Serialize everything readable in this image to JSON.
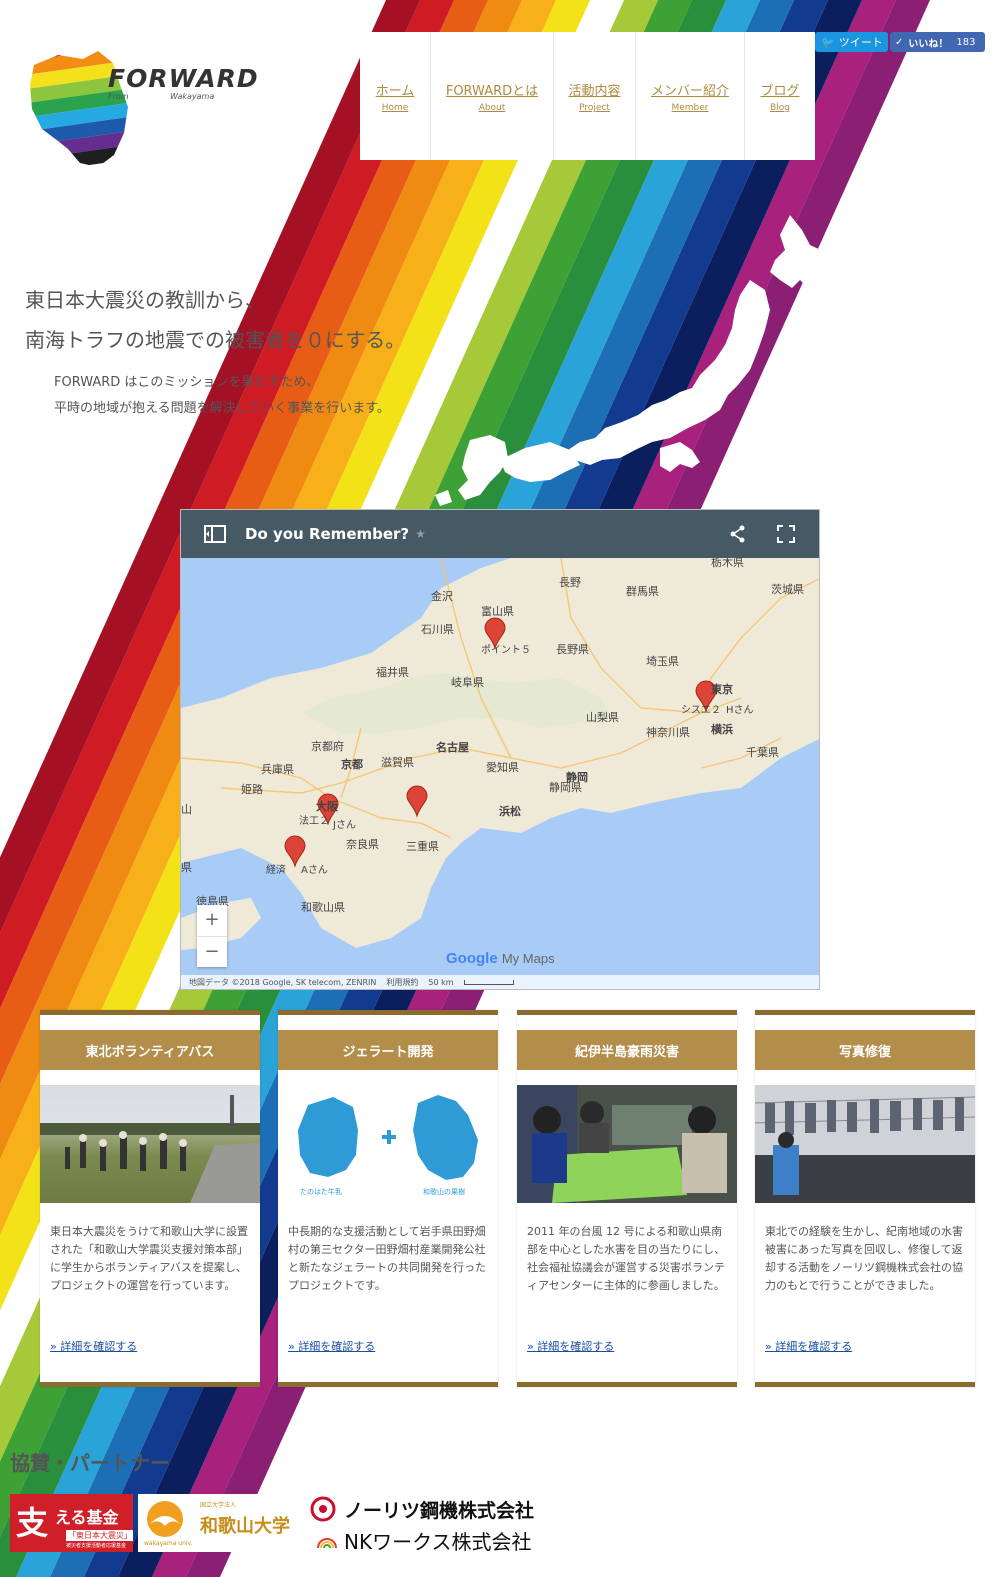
{
  "header": {
    "logo_text": "FORWARD",
    "logo_from": "From",
    "logo_wakayama": "Wakayama",
    "nav": [
      {
        "jp": "ホーム",
        "en": "Home"
      },
      {
        "jp": "FORWARDとは",
        "en": "About"
      },
      {
        "jp": "活動内容",
        "en": "Project"
      },
      {
        "jp": "メンバー紹介",
        "en": "Member"
      },
      {
        "jp": "ブログ",
        "en": "Blog"
      }
    ],
    "social": {
      "tweet": "ツイート",
      "like": "いいね！",
      "like_count": "183"
    }
  },
  "hero": {
    "line1": "東日本大震災の教訓から、",
    "line2": "南海トラフの地震での被害者を０にする。",
    "desc1": "FORWARD はこのミッションを果たすため、",
    "desc2": "平時の地域が抱える問題を解決していく事業を行います。"
  },
  "map": {
    "title": "Do you Remember?",
    "labels": [
      "栃木県",
      "長野",
      "群馬県",
      "茨城県",
      "金沢",
      "富山県",
      "石川県",
      "長野県",
      "ポイント５",
      "福井県",
      "岐阜県",
      "埼玉県",
      "東京",
      "シスエ２",
      "Hさん",
      "山梨県",
      "神奈川県",
      "横浜",
      "千葉県",
      "京都府",
      "名古屋",
      "滋賀県",
      "京都",
      "兵庫県",
      "愛知県",
      "静岡",
      "姫路",
      "大阪",
      "静岡県",
      "浜松",
      "法工２",
      "Jさん",
      "奈良県",
      "三重県",
      "経済",
      "Aさん",
      "県",
      "徳島県",
      "和歌山県",
      "山"
    ],
    "zoom_in": "+",
    "zoom_out": "−",
    "brand_google": "Google",
    "brand_mymaps": "My Maps",
    "footer": {
      "data": "地図データ ©2018 Google, SK telecom, ZENRIN",
      "terms": "利用規約",
      "scale": "50 km"
    }
  },
  "cards": [
    {
      "title": "東北ボランティアバス",
      "text": "東日本大震災をうけて和歌山大学に設置された「和歌山大学震災支援対策本部」に学生からボランティアバスを提案し、プロジェクトの運営を行っています。",
      "link": "» 詳細を確認する"
    },
    {
      "title": "ジェラート開発",
      "text": "中長期的な支援活動として岩手県田野畑村の第三セクター田野畑村産業開発公社と新たなジェラートの共同開発を行ったプロジェクトです。",
      "link": "» 詳細を確認する",
      "img_left": "たのはた牛乳",
      "img_right": "和歌山の果樹"
    },
    {
      "title": "紀伊半島豪雨災害",
      "text": "2011 年の台風 12 号による和歌山県南部を中心とした水害を目の当たりにし、社会福祉協議会が運営する災害ボランティアセンターに主体的に参画しました。",
      "link": "» 詳細を確認する"
    },
    {
      "title": "写真修復",
      "text": "東北での経験を生かし、紀南地域の水害被害にあった写真を回収し、修復して返却する活動をノーリツ鋼機株式会社の協力のもとで行うことができました。",
      "link": "» 詳細を確認する"
    }
  ],
  "partners": {
    "title": "協賛・パートナー",
    "sasaeru": {
      "big": "支",
      "text": "える基金",
      "sub1": "「東日本大震災」",
      "sub2": "被災者支援活動者応援基金"
    },
    "wakayama": {
      "small": "国立大学法人",
      "name": "和歌山大学",
      "en": "wakayama univ."
    },
    "noritsu": "ノーリツ鋼機株式会社",
    "nkworks": "NKワークス株式会社"
  },
  "colors": {
    "gold": "#b38e4b",
    "gold_dark": "#8c6c2e",
    "link": "#1a4fa0",
    "map_bar": "#455a64"
  }
}
